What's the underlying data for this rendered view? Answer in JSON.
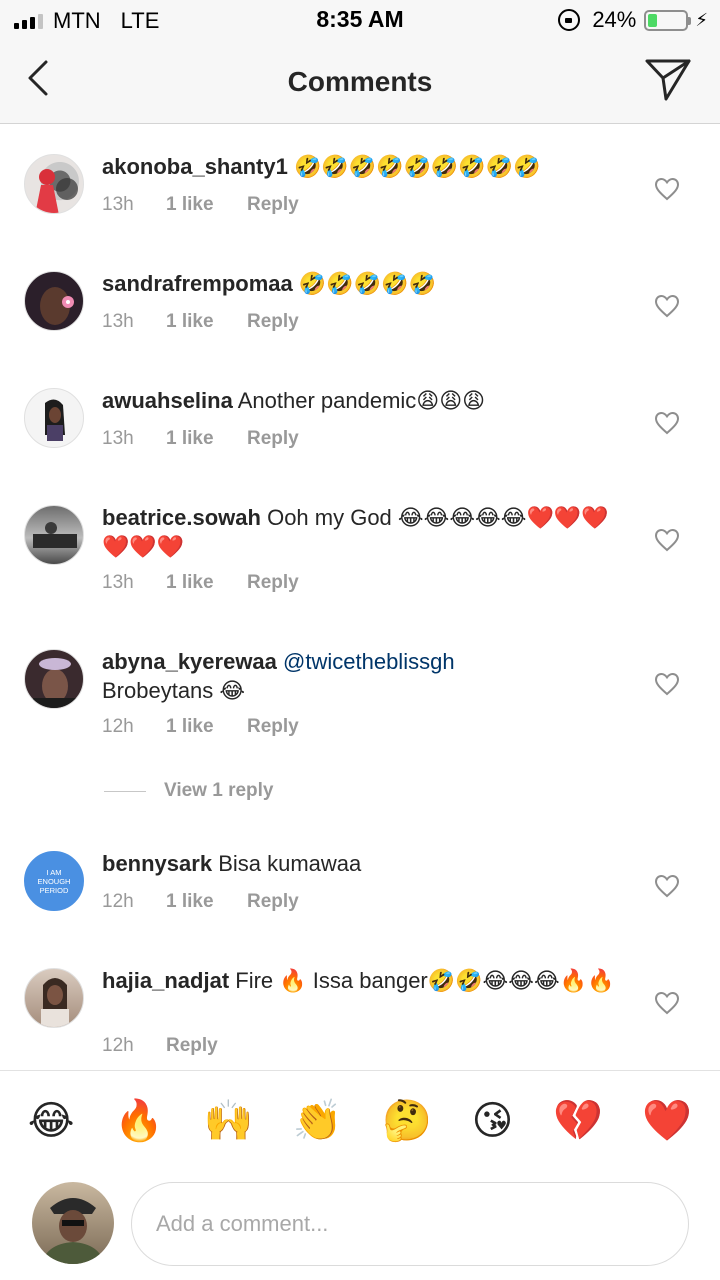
{
  "status_bar": {
    "carrier": "MTN",
    "network": "LTE",
    "time": "8:35 AM",
    "battery": "24%",
    "battery_level": 0.24
  },
  "header": {
    "title": "Comments"
  },
  "comments": [
    {
      "user": "akonoba_shanty1",
      "text": "🤣🤣🤣🤣🤣🤣🤣🤣🤣",
      "time": "13h",
      "likes": "1 like",
      "reply": "Reply"
    },
    {
      "user": "sandrafrempomaa",
      "text": "🤣🤣🤣🤣🤣",
      "time": "13h",
      "likes": "1 like",
      "reply": "Reply"
    },
    {
      "user": "awuahselina",
      "text": "Another pandemic😩😩😩",
      "time": "13h",
      "likes": "1 like",
      "reply": "Reply"
    },
    {
      "user": "beatrice.sowah",
      "text": "Ooh my God 😂😂😂😂😂❤️❤️❤️❤️❤️❤️",
      "time": "13h",
      "likes": "1 like",
      "reply": "Reply"
    },
    {
      "user": "abyna_kyerewaa",
      "mention": "@twicetheblissgh",
      "text": "Brobeytans 😂",
      "time": "12h",
      "likes": "1 like",
      "reply": "Reply"
    },
    {
      "user": "bennysark",
      "text": "Bisa kumawaa",
      "time": "12h",
      "likes": "1 like",
      "reply": "Reply"
    },
    {
      "user": "hajia_nadjat",
      "text": "Fire 🔥 Issa banger🤣🤣😂😂😂🔥🔥",
      "time": "12h",
      "reply": "Reply"
    }
  ],
  "view_replies": "View 1 reply",
  "avatar_text": "I AM ENOUGH PERIOD",
  "emoji_bar": [
    "😂",
    "🔥",
    "🙌",
    "👏",
    "🤔",
    "😘",
    "💔",
    "❤️"
  ],
  "composer": {
    "placeholder": "Add a comment..."
  }
}
